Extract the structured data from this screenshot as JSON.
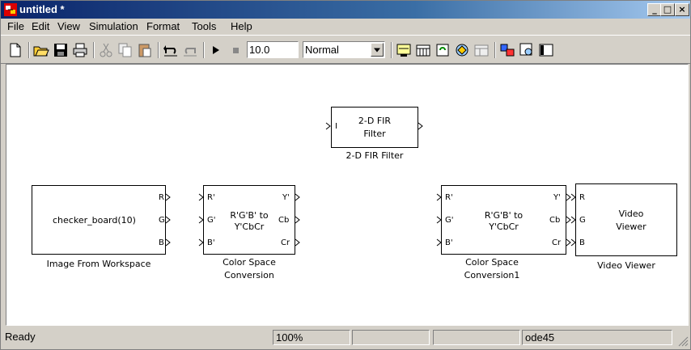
{
  "window": {
    "title": "untitled *"
  },
  "menubar": {
    "items": [
      "File",
      "Edit",
      "View",
      "Simulation",
      "Format",
      "Tools",
      "Help"
    ]
  },
  "toolbar": {
    "stop_time": "10.0",
    "mode": "Normal"
  },
  "blocks": {
    "fir": {
      "text1": "2-D FIR",
      "text2": "Filter",
      "caption": "2-D FIR Filter",
      "in_port": "I"
    },
    "image": {
      "text": "checker_board(10)",
      "caption": "Image From Workspace",
      "ports": [
        "R",
        "G",
        "B"
      ]
    },
    "csc1": {
      "text1": "R'G'B' to",
      "text2": "Y'CbCr",
      "caption1": "Color Space",
      "caption2": "Conversion",
      "in_ports": [
        "R'",
        "G'",
        "B'"
      ],
      "out_ports": [
        "Y'",
        "Cb",
        "Cr"
      ]
    },
    "csc2": {
      "text1": "R'G'B' to",
      "text2": "Y'CbCr",
      "caption1": "Color Space",
      "caption2": "Conversion1",
      "in_ports": [
        "R'",
        "G'",
        "B'"
      ],
      "out_ports": [
        "Y'",
        "Cb",
        "Cr"
      ]
    },
    "viewer": {
      "text1": "Video",
      "text2": "Viewer",
      "caption": "Video Viewer",
      "in_ports": [
        "R",
        "G",
        "B"
      ]
    }
  },
  "statusbar": {
    "status": "Ready",
    "zoom": "100%",
    "solver": "ode45"
  },
  "icons": [
    "new-icon",
    "open-icon",
    "save-icon",
    "print-icon",
    "cut-icon",
    "copy-icon",
    "paste-icon",
    "undo-icon",
    "redo-icon",
    "play-icon",
    "stop-icon"
  ]
}
